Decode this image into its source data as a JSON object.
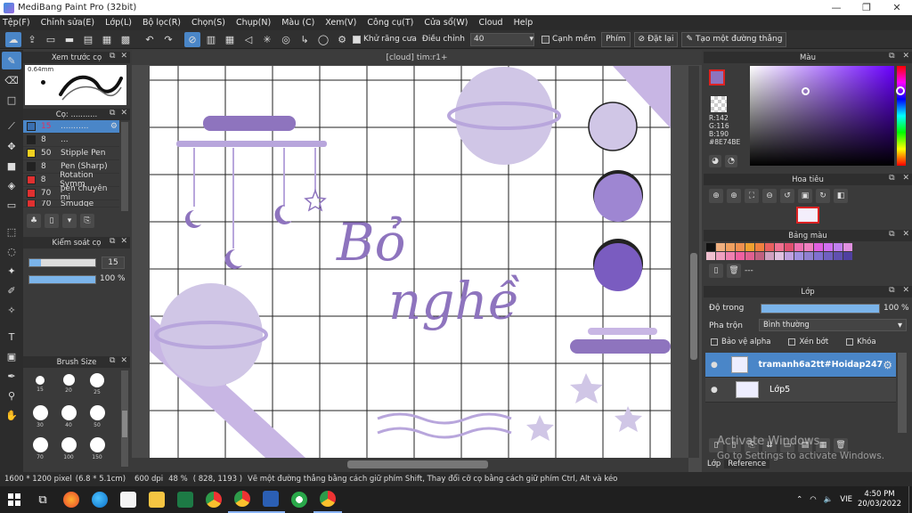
{
  "window": {
    "title": "MediBang Paint Pro (32bit)",
    "controls": [
      "—",
      "❐",
      "✕"
    ]
  },
  "menu": [
    "Tệp(F)",
    "Chỉnh sửa(E)",
    "Lớp(L)",
    "Bộ lọc(R)",
    "Chọn(S)",
    "Chụp(N)",
    "Màu (C)",
    "Xem(V)",
    "Công cụ(T)",
    "Cửa sổ(W)",
    "Cloud",
    "Help"
  ],
  "toolbar": {
    "antialias_label": "Khử răng cưa",
    "adjust_label": "Điều chỉnh",
    "adjust_value": "40",
    "snap_label": "Cạnh mềm",
    "key_label": "Phím",
    "reset_label": "Đặt lại",
    "line_label": "Tạo một đường thẳng"
  },
  "document_tab": "[cloud] tim:r1+",
  "brush_preview": {
    "title": "Xem trước cọ",
    "size": "0.64mm"
  },
  "brush_panel": {
    "title": "Cọ: ...........",
    "items": [
      {
        "size": "15",
        "name": "...........",
        "color": "#3a6fb0",
        "selected": true
      },
      {
        "size": "8",
        "name": "...",
        "color": "#222222",
        "selected": false
      },
      {
        "size": "50",
        "name": "Stipple Pen",
        "color": "#f0d020",
        "selected": false
      },
      {
        "size": "8",
        "name": "Pen (Sharp)",
        "color": "#222222",
        "selected": false
      },
      {
        "size": "8",
        "name": "Rotation Symm",
        "color": "#e03030",
        "selected": false
      },
      {
        "size": "70",
        "name": "pen chuyên mi",
        "color": "#e03030",
        "selected": false
      },
      {
        "size": "70",
        "name": "Smudge",
        "color": "#e03030",
        "selected": false
      }
    ]
  },
  "brush_control": {
    "title": "Kiểm soát cọ",
    "size_value": "15",
    "opacity_value": "100 %",
    "size_fraction": 0.18,
    "opacity_fraction": 1.0
  },
  "brush_size": {
    "title": "Brush Size",
    "sizes": [
      "15",
      "20",
      "25",
      "30",
      "40",
      "50",
      "70",
      "100",
      "150"
    ]
  },
  "color_panel": {
    "title": "Màu",
    "r": "R:142",
    "g": "G:116",
    "b": "B:190",
    "hex": "#8E74BE",
    "primary": "#8e74be",
    "secondary": "#3a4fc0"
  },
  "navigator": {
    "title": "Hoa tiêu"
  },
  "palette": {
    "title": "Bảng màu",
    "extra": "---",
    "rows": [
      [
        "#111111",
        "#f0b080",
        "#f0a060",
        "#f09050",
        "#f0a030",
        "#f08040",
        "#e86060",
        "#f07090",
        "#e05070",
        "#f070b0",
        "#f080c0",
        "#e060e0",
        "#d070f0",
        "#c080f0",
        "#e090e0"
      ],
      [
        "#f0c0d0",
        "#f0a0c0",
        "#f080b0",
        "#f060a0",
        "#e06090",
        "#c06080",
        "#d0a0c0",
        "#e0c0e0",
        "#c0a0e0",
        "#a090e0",
        "#9080d0",
        "#8070d0",
        "#7060c0",
        "#6050b0",
        "#5040a0"
      ]
    ]
  },
  "layers": {
    "title": "Lớp",
    "opacity_label": "Độ trong",
    "opacity_value": "100 %",
    "opacity_fraction": 1.0,
    "blend_label": "Pha trộn",
    "blend_value": "Bình thường",
    "protect_alpha": "Bảo vệ alpha",
    "clipping": "Xén bớt",
    "lock": "Khóa",
    "items": [
      {
        "name": "tramanh6a2tt#Hoidap247",
        "selected": true
      },
      {
        "name": "Lớp5",
        "selected": false
      }
    ],
    "tabs": [
      "Lớp",
      "Reference"
    ]
  },
  "watermark": {
    "line1": "Activate Windows",
    "line2": "Go to Settings to activate Windows."
  },
  "status": {
    "pixels": "1600 * 1200 pixel",
    "cm": "(6.8 * 5.1cm)",
    "dpi": "600 dpi",
    "zoom": "48 %",
    "coords": "( 828, 1193 )",
    "hint": "Vẽ một đường thẳng bằng cách giữ phím Shift, Thay đổi cỡ cọ bằng cách giữ phím Ctrl, Alt và kéo"
  },
  "canvas_text": {
    "line1": "Bỏ",
    "line2": "nghề"
  },
  "taskbar": {
    "lang": "VIE",
    "time": "4:50 PM",
    "date": "20/03/2022"
  }
}
